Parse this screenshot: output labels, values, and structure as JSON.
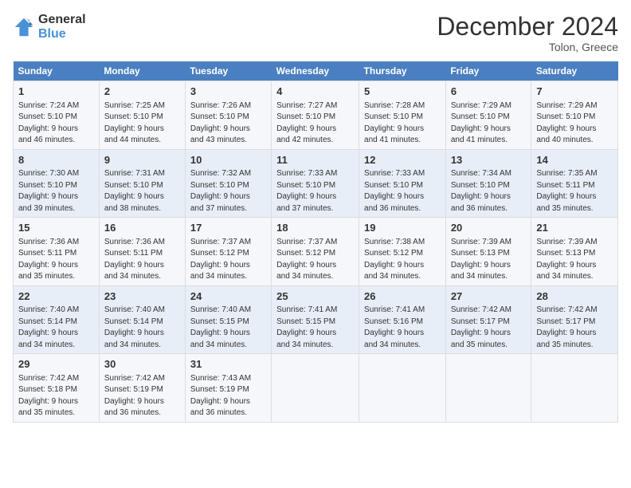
{
  "logo": {
    "line1": "General",
    "line2": "Blue"
  },
  "title": "December 2024",
  "subtitle": "Tolon, Greece",
  "days_of_week": [
    "Sunday",
    "Monday",
    "Tuesday",
    "Wednesday",
    "Thursday",
    "Friday",
    "Saturday"
  ],
  "weeks": [
    [
      {
        "day": "1",
        "info": "Sunrise: 7:24 AM\nSunset: 5:10 PM\nDaylight: 9 hours\nand 46 minutes."
      },
      {
        "day": "2",
        "info": "Sunrise: 7:25 AM\nSunset: 5:10 PM\nDaylight: 9 hours\nand 44 minutes."
      },
      {
        "day": "3",
        "info": "Sunrise: 7:26 AM\nSunset: 5:10 PM\nDaylight: 9 hours\nand 43 minutes."
      },
      {
        "day": "4",
        "info": "Sunrise: 7:27 AM\nSunset: 5:10 PM\nDaylight: 9 hours\nand 42 minutes."
      },
      {
        "day": "5",
        "info": "Sunrise: 7:28 AM\nSunset: 5:10 PM\nDaylight: 9 hours\nand 41 minutes."
      },
      {
        "day": "6",
        "info": "Sunrise: 7:29 AM\nSunset: 5:10 PM\nDaylight: 9 hours\nand 41 minutes."
      },
      {
        "day": "7",
        "info": "Sunrise: 7:29 AM\nSunset: 5:10 PM\nDaylight: 9 hours\nand 40 minutes."
      }
    ],
    [
      {
        "day": "8",
        "info": "Sunrise: 7:30 AM\nSunset: 5:10 PM\nDaylight: 9 hours\nand 39 minutes."
      },
      {
        "day": "9",
        "info": "Sunrise: 7:31 AM\nSunset: 5:10 PM\nDaylight: 9 hours\nand 38 minutes."
      },
      {
        "day": "10",
        "info": "Sunrise: 7:32 AM\nSunset: 5:10 PM\nDaylight: 9 hours\nand 37 minutes."
      },
      {
        "day": "11",
        "info": "Sunrise: 7:33 AM\nSunset: 5:10 PM\nDaylight: 9 hours\nand 37 minutes."
      },
      {
        "day": "12",
        "info": "Sunrise: 7:33 AM\nSunset: 5:10 PM\nDaylight: 9 hours\nand 36 minutes."
      },
      {
        "day": "13",
        "info": "Sunrise: 7:34 AM\nSunset: 5:10 PM\nDaylight: 9 hours\nand 36 minutes."
      },
      {
        "day": "14",
        "info": "Sunrise: 7:35 AM\nSunset: 5:11 PM\nDaylight: 9 hours\nand 35 minutes."
      }
    ],
    [
      {
        "day": "15",
        "info": "Sunrise: 7:36 AM\nSunset: 5:11 PM\nDaylight: 9 hours\nand 35 minutes."
      },
      {
        "day": "16",
        "info": "Sunrise: 7:36 AM\nSunset: 5:11 PM\nDaylight: 9 hours\nand 34 minutes."
      },
      {
        "day": "17",
        "info": "Sunrise: 7:37 AM\nSunset: 5:12 PM\nDaylight: 9 hours\nand 34 minutes."
      },
      {
        "day": "18",
        "info": "Sunrise: 7:37 AM\nSunset: 5:12 PM\nDaylight: 9 hours\nand 34 minutes."
      },
      {
        "day": "19",
        "info": "Sunrise: 7:38 AM\nSunset: 5:12 PM\nDaylight: 9 hours\nand 34 minutes."
      },
      {
        "day": "20",
        "info": "Sunrise: 7:39 AM\nSunset: 5:13 PM\nDaylight: 9 hours\nand 34 minutes."
      },
      {
        "day": "21",
        "info": "Sunrise: 7:39 AM\nSunset: 5:13 PM\nDaylight: 9 hours\nand 34 minutes."
      }
    ],
    [
      {
        "day": "22",
        "info": "Sunrise: 7:40 AM\nSunset: 5:14 PM\nDaylight: 9 hours\nand 34 minutes."
      },
      {
        "day": "23",
        "info": "Sunrise: 7:40 AM\nSunset: 5:14 PM\nDaylight: 9 hours\nand 34 minutes."
      },
      {
        "day": "24",
        "info": "Sunrise: 7:40 AM\nSunset: 5:15 PM\nDaylight: 9 hours\nand 34 minutes."
      },
      {
        "day": "25",
        "info": "Sunrise: 7:41 AM\nSunset: 5:15 PM\nDaylight: 9 hours\nand 34 minutes."
      },
      {
        "day": "26",
        "info": "Sunrise: 7:41 AM\nSunset: 5:16 PM\nDaylight: 9 hours\nand 34 minutes."
      },
      {
        "day": "27",
        "info": "Sunrise: 7:42 AM\nSunset: 5:17 PM\nDaylight: 9 hours\nand 35 minutes."
      },
      {
        "day": "28",
        "info": "Sunrise: 7:42 AM\nSunset: 5:17 PM\nDaylight: 9 hours\nand 35 minutes."
      }
    ],
    [
      {
        "day": "29",
        "info": "Sunrise: 7:42 AM\nSunset: 5:18 PM\nDaylight: 9 hours\nand 35 minutes."
      },
      {
        "day": "30",
        "info": "Sunrise: 7:42 AM\nSunset: 5:19 PM\nDaylight: 9 hours\nand 36 minutes."
      },
      {
        "day": "31",
        "info": "Sunrise: 7:43 AM\nSunset: 5:19 PM\nDaylight: 9 hours\nand 36 minutes."
      },
      {
        "day": "",
        "info": ""
      },
      {
        "day": "",
        "info": ""
      },
      {
        "day": "",
        "info": ""
      },
      {
        "day": "",
        "info": ""
      }
    ]
  ]
}
